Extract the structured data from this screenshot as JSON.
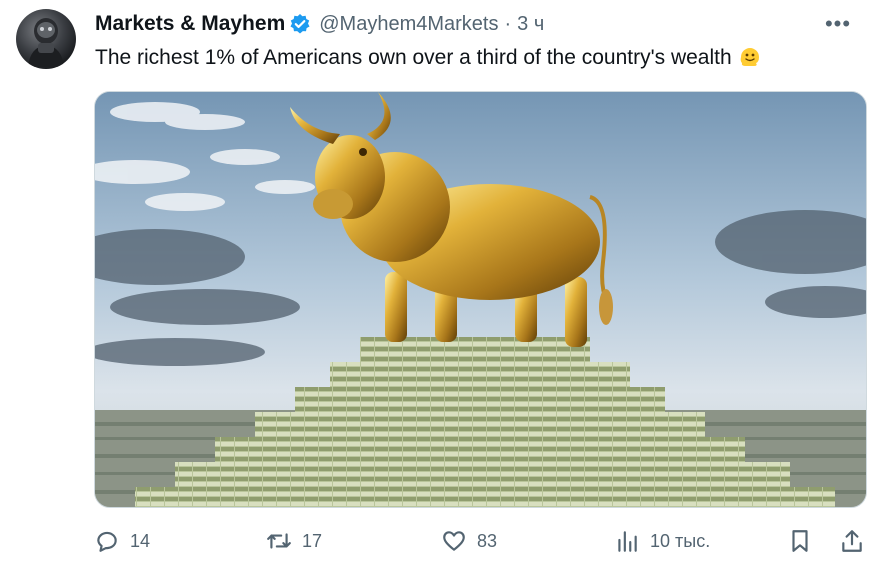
{
  "tweet": {
    "author_name": "Markets & Mayhem",
    "handle": "@Mayhem4Markets",
    "separator": "·",
    "time": "3 ч",
    "text": "The richest 1% of Americans own over a third of the country's wealth",
    "more_label": "•••",
    "emoji_icon": "melting-face-emoji",
    "media_icon": "golden-bull-on-money-pyramid-image"
  },
  "actions": {
    "reply_count": "14",
    "retweet_count": "17",
    "like_count": "83",
    "views_count": "10 тыс."
  },
  "colors": {
    "verified": "#1d9bf0",
    "secondary_text": "#536471",
    "primary_text": "#0f1419"
  }
}
